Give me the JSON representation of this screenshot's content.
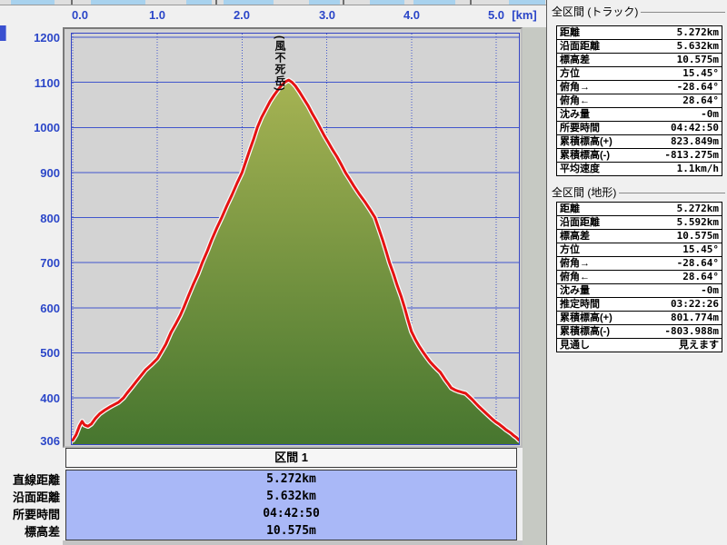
{
  "axes": {
    "x_ticks": [
      "0.0",
      "1.0",
      "2.0",
      "3.0",
      "4.0",
      "5.0"
    ],
    "x_unit": "[km]",
    "y_ticks": [
      "1200",
      "1100",
      "1000",
      "900",
      "800",
      "700",
      "600",
      "500",
      "400",
      "306"
    ]
  },
  "chart_data": {
    "type": "area",
    "xlabel": "[km]",
    "ylabel": "",
    "xlim": [
      0,
      5.27
    ],
    "ylim": [
      306,
      1200
    ],
    "grid": true,
    "x_gridlines": [
      0,
      1,
      2,
      3,
      4,
      5
    ],
    "y_gridlines": [
      1200,
      1100,
      1000,
      900,
      800,
      700,
      600,
      500,
      400
    ],
    "annotation": "(風不死岳)",
    "line_color": "#e51212",
    "fill_top_color": "#a6b353",
    "fill_bottom_color": "#47762f",
    "profile": [
      [
        0.0,
        306
      ],
      [
        0.04,
        318
      ],
      [
        0.08,
        338
      ],
      [
        0.11,
        348
      ],
      [
        0.14,
        340
      ],
      [
        0.18,
        337
      ],
      [
        0.22,
        342
      ],
      [
        0.27,
        355
      ],
      [
        0.32,
        365
      ],
      [
        0.38,
        373
      ],
      [
        0.45,
        381
      ],
      [
        0.54,
        390
      ],
      [
        0.6,
        400
      ],
      [
        0.64,
        410
      ],
      [
        0.7,
        424
      ],
      [
        0.75,
        436
      ],
      [
        0.8,
        448
      ],
      [
        0.86,
        462
      ],
      [
        0.93,
        474
      ],
      [
        1.0,
        487
      ],
      [
        1.05,
        503
      ],
      [
        1.1,
        519
      ],
      [
        1.16,
        545
      ],
      [
        1.22,
        565
      ],
      [
        1.27,
        583
      ],
      [
        1.31,
        600
      ],
      [
        1.37,
        628
      ],
      [
        1.42,
        650
      ],
      [
        1.48,
        675
      ],
      [
        1.53,
        700
      ],
      [
        1.59,
        726
      ],
      [
        1.64,
        750
      ],
      [
        1.7,
        776
      ],
      [
        1.76,
        800
      ],
      [
        1.82,
        826
      ],
      [
        1.88,
        850
      ],
      [
        1.94,
        876
      ],
      [
        2.0,
        900
      ],
      [
        2.05,
        928
      ],
      [
        2.09,
        950
      ],
      [
        2.14,
        976
      ],
      [
        2.18,
        1000
      ],
      [
        2.23,
        1022
      ],
      [
        2.28,
        1040
      ],
      [
        2.33,
        1058
      ],
      [
        2.38,
        1072
      ],
      [
        2.43,
        1085
      ],
      [
        2.47,
        1094
      ],
      [
        2.51,
        1101
      ],
      [
        2.55,
        1105
      ],
      [
        2.59,
        1100
      ],
      [
        2.63,
        1092
      ],
      [
        2.68,
        1078
      ],
      [
        2.72,
        1066
      ],
      [
        2.78,
        1048
      ],
      [
        2.83,
        1030
      ],
      [
        2.88,
        1014
      ],
      [
        2.92,
        1000
      ],
      [
        2.97,
        982
      ],
      [
        3.02,
        966
      ],
      [
        3.07,
        950
      ],
      [
        3.12,
        935
      ],
      [
        3.17,
        918
      ],
      [
        3.22,
        900
      ],
      [
        3.27,
        885
      ],
      [
        3.32,
        870
      ],
      [
        3.38,
        853
      ],
      [
        3.45,
        835
      ],
      [
        3.51,
        818
      ],
      [
        3.57,
        800
      ],
      [
        3.62,
        772
      ],
      [
        3.66,
        750
      ],
      [
        3.7,
        726
      ],
      [
        3.74,
        700
      ],
      [
        3.79,
        674
      ],
      [
        3.83,
        650
      ],
      [
        3.88,
        624
      ],
      [
        3.92,
        600
      ],
      [
        3.96,
        572
      ],
      [
        4.0,
        547
      ],
      [
        4.05,
        528
      ],
      [
        4.09,
        515
      ],
      [
        4.14,
        501
      ],
      [
        4.18,
        490
      ],
      [
        4.22,
        480
      ],
      [
        4.26,
        472
      ],
      [
        4.3,
        464
      ],
      [
        4.34,
        457
      ],
      [
        4.4,
        440
      ],
      [
        4.44,
        430
      ],
      [
        4.47,
        422
      ],
      [
        4.51,
        418
      ],
      [
        4.55,
        415
      ],
      [
        4.6,
        412
      ],
      [
        4.64,
        410
      ],
      [
        4.68,
        403
      ],
      [
        4.72,
        396
      ],
      [
        4.76,
        388
      ],
      [
        4.8,
        380
      ],
      [
        4.84,
        373
      ],
      [
        4.88,
        366
      ],
      [
        4.92,
        359
      ],
      [
        4.96,
        352
      ],
      [
        5.0,
        346
      ],
      [
        5.04,
        341
      ],
      [
        5.08,
        335
      ],
      [
        5.11,
        330
      ],
      [
        5.15,
        325
      ],
      [
        5.18,
        321
      ],
      [
        5.21,
        316
      ],
      [
        5.24,
        312
      ],
      [
        5.27,
        306
      ]
    ]
  },
  "segment_summary": {
    "header": "区間 1",
    "rows": [
      {
        "label": "直線距離",
        "value": "5.272km"
      },
      {
        "label": "沿面距離",
        "value": "5.632km"
      },
      {
        "label": "所要時間",
        "value": "04:42:50"
      },
      {
        "label": "標高差",
        "value": "10.575m"
      }
    ]
  },
  "panel_track": {
    "title": "全区間 (トラック)",
    "rows": [
      {
        "label": "距離",
        "value": "5.272km"
      },
      {
        "label": "沿面距離",
        "value": "5.632km"
      },
      {
        "label": "標高差",
        "value": "10.575m"
      },
      {
        "label": "方位",
        "value": "15.45°"
      },
      {
        "label": "俯角→",
        "value": "-28.64°"
      },
      {
        "label": "俯角←",
        "value": "28.64°"
      },
      {
        "label": "沈み量",
        "value": "-0m"
      },
      {
        "label": "所要時間",
        "value": "04:42:50"
      },
      {
        "label": "累積標高(+)",
        "value": "823.849m"
      },
      {
        "label": "累積標高(-)",
        "value": "-813.275m"
      },
      {
        "label": "平均速度",
        "value": "1.1km/h"
      }
    ]
  },
  "panel_terrain": {
    "title": "全区間 (地形)",
    "rows": [
      {
        "label": "距離",
        "value": "5.272km"
      },
      {
        "label": "沿面距離",
        "value": "5.592km"
      },
      {
        "label": "標高差",
        "value": "10.575m"
      },
      {
        "label": "方位",
        "value": "15.45°"
      },
      {
        "label": "俯角→",
        "value": "-28.64°"
      },
      {
        "label": "俯角←",
        "value": "28.64°"
      },
      {
        "label": "沈み量",
        "value": "-0m"
      },
      {
        "label": "推定時間",
        "value": "03:22:26"
      },
      {
        "label": "累積標高(+)",
        "value": "801.774m"
      },
      {
        "label": "累積標高(-)",
        "value": "-803.988m"
      },
      {
        "label": "見通し",
        "value": "見えます"
      }
    ]
  }
}
